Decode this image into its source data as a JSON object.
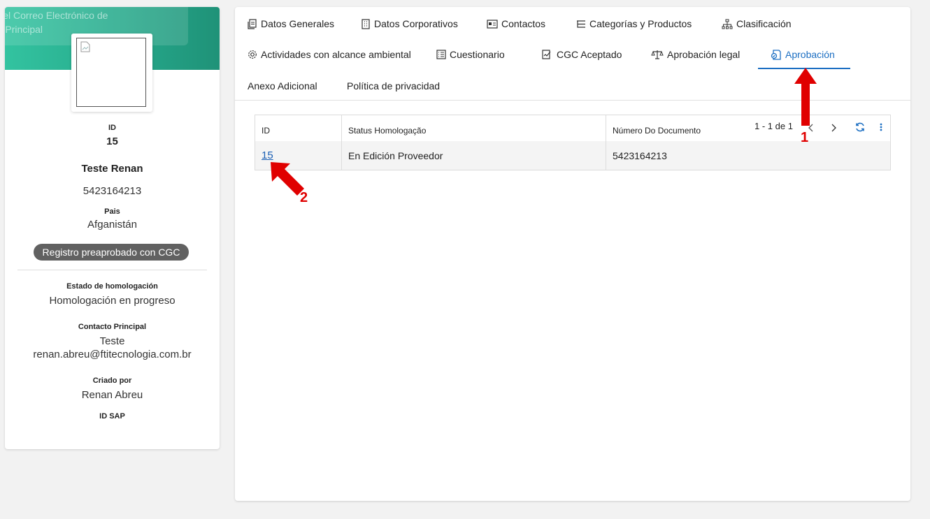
{
  "profile": {
    "banner_tip_line1": "piar el Correo Electrónico de",
    "banner_tip_line2": "acto Principal",
    "id_label": "ID",
    "id_value": "15",
    "name": "Teste Renan",
    "document": "5423164213",
    "country_label": "Pais",
    "country_value": "Afganistán",
    "status_badge": "Registro preaprobado con CGC",
    "homologation_label": "Estado de homologación",
    "homologation_value": "Homologación en progreso",
    "contact_label": "Contacto Principal",
    "contact_name": "Teste",
    "contact_email": "renan.abreu@ftitecnologia.com.br",
    "created_label": "Criado por",
    "created_value": "Renan Abreu",
    "sap_label": "ID SAP"
  },
  "tabs": {
    "datos_generales": "Datos Generales",
    "datos_corporativos": "Datos Corporativos",
    "contactos": "Contactos",
    "categorias": "Categorías y Productos",
    "clasificacion": "Clasificación",
    "actividades": "Actividades con alcance ambiental",
    "cuestionario": "Cuestionario",
    "cgc": "CGC Aceptado",
    "aprobacion_legal": "Aprobación legal",
    "aprobacion": "Aprobación",
    "anexo": "Anexo Adicional",
    "politica": "Política de privacidad",
    "active": "Aprobación"
  },
  "grid": {
    "headers": [
      "ID",
      "Status Homologação",
      "Número Do Documento"
    ],
    "rows": [
      {
        "id": "15",
        "status": "En Edición Proveedor",
        "documento": "5423164213"
      }
    ],
    "pager_text": "1 - 1 de 1"
  },
  "annotations": {
    "one": "1",
    "two": "2"
  },
  "colors": {
    "accent": "#1b6ec2",
    "banner": "#26a98b",
    "annotation": "#e00000",
    "badge": "#616161"
  }
}
